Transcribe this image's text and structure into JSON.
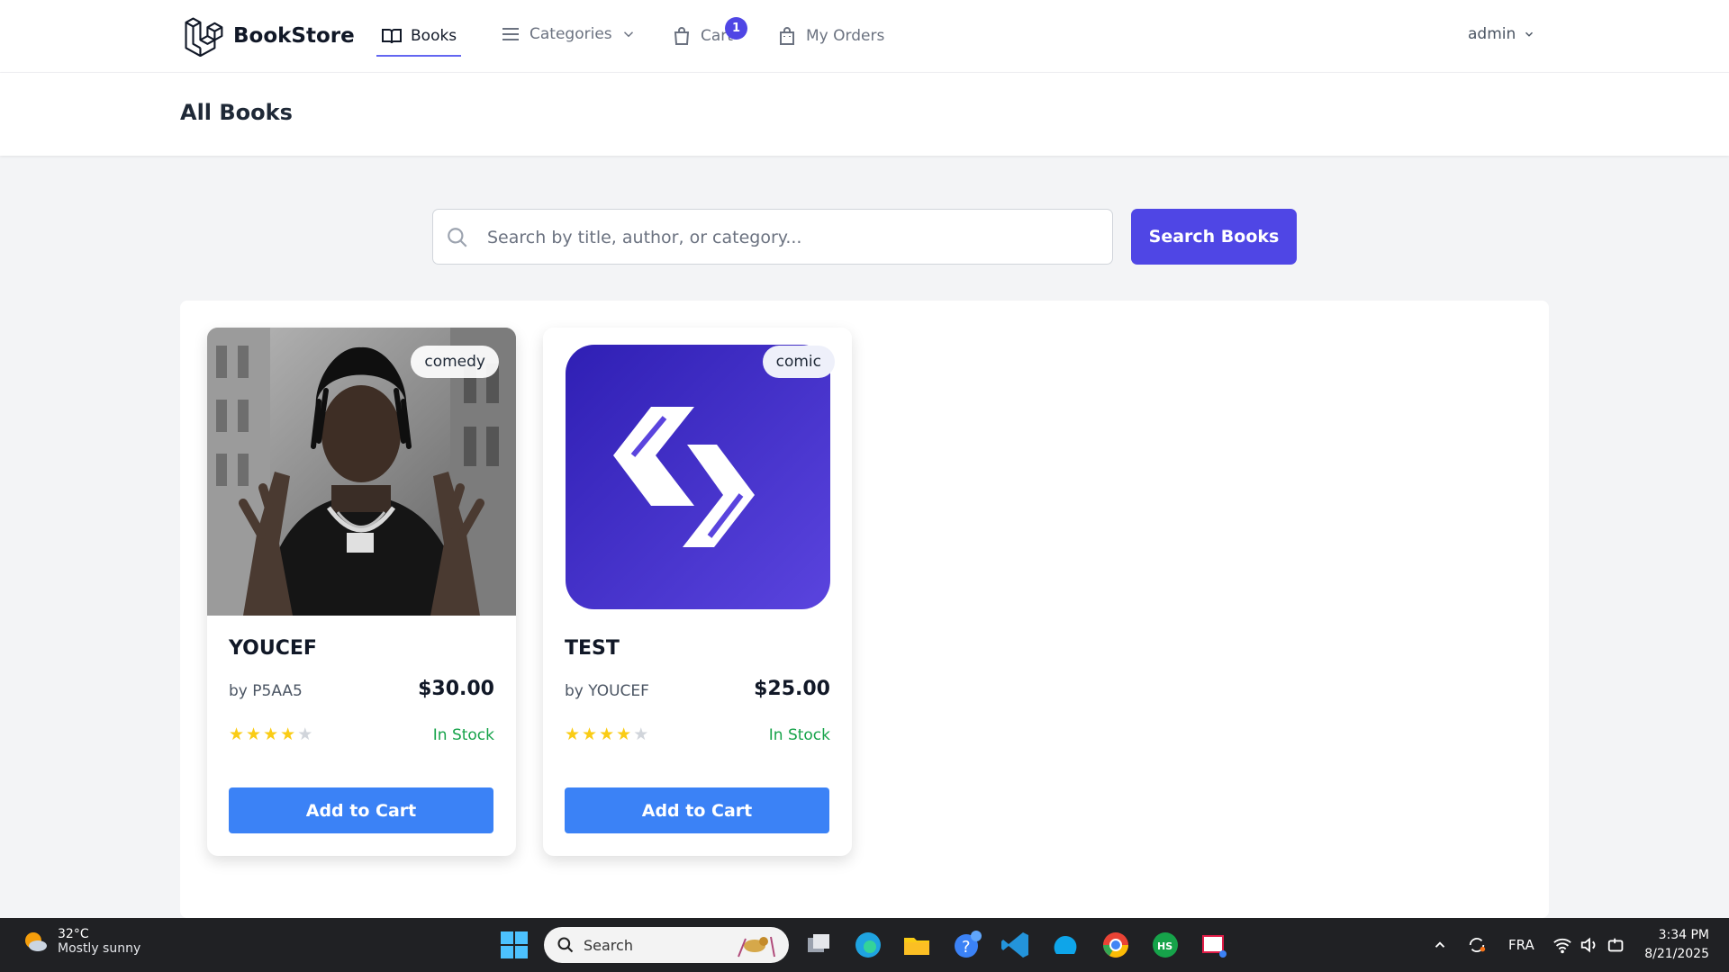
{
  "nav": {
    "brand": "BookStore",
    "books": "Books",
    "categories": "Categories",
    "cart": "Cart",
    "cart_count": "1",
    "orders": "My Orders",
    "user": "admin"
  },
  "header": {
    "title": "All Books"
  },
  "search": {
    "placeholder": "Search by title, author, or category...",
    "button": "Search Books"
  },
  "books": [
    {
      "title": "YOUCEF",
      "author": "by P5AA5",
      "price": "$30.00",
      "category": "comedy",
      "rating": 4,
      "stock": "In Stock",
      "button": "Add to Cart"
    },
    {
      "title": "TEST",
      "author": "by YOUCEF",
      "price": "$25.00",
      "category": "comic",
      "rating": 4,
      "stock": "In Stock",
      "button": "Add to Cart"
    }
  ],
  "taskbar": {
    "temperature": "32°C",
    "weather": "Mostly sunny",
    "search": "Search",
    "language": "FRA",
    "time": "3:34 PM",
    "date": "8/21/2025"
  },
  "colors": {
    "accent": "#4f46e5",
    "button": "#3b82f6",
    "stock": "#16a34a",
    "star": "#facc15"
  }
}
